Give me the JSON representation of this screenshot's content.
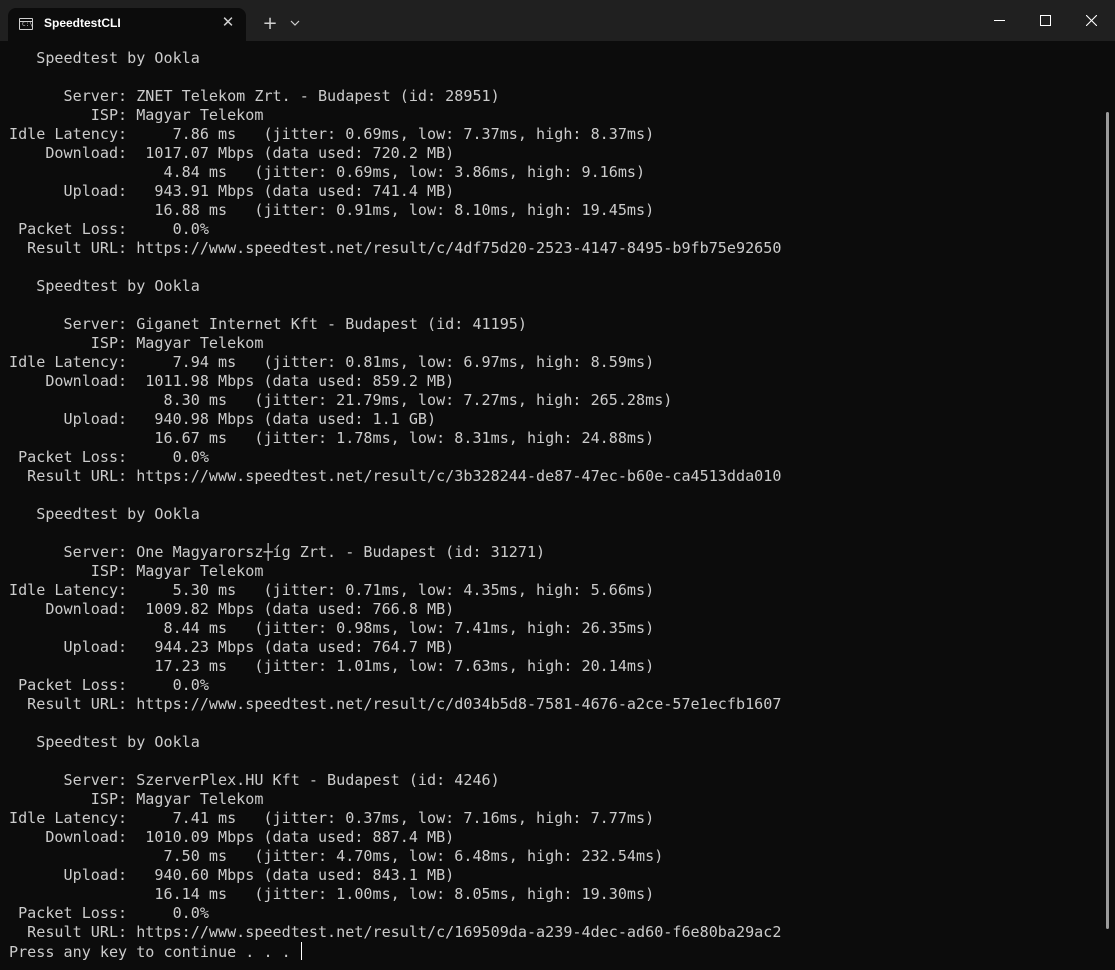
{
  "window": {
    "tab_title": "SpeedtestCLI",
    "tab_icon": "terminal-icon",
    "new_tab_label": "+",
    "close_tab_label": "✕"
  },
  "colors": {
    "background": "#0c0c0c",
    "titlebar": "#202020",
    "text": "#cccccc"
  },
  "terminal": {
    "lines": [
      "   Speedtest by Ookla",
      "",
      "      Server: ZNET Telekom Zrt. - Budapest (id: 28951)",
      "         ISP: Magyar Telekom",
      "Idle Latency:     7.86 ms   (jitter: 0.69ms, low: 7.37ms, high: 8.37ms)",
      "    Download:  1017.07 Mbps (data used: 720.2 MB)",
      "                 4.84 ms   (jitter: 0.69ms, low: 3.86ms, high: 9.16ms)",
      "      Upload:   943.91 Mbps (data used: 741.4 MB)",
      "                16.88 ms   (jitter: 0.91ms, low: 8.10ms, high: 19.45ms)",
      " Packet Loss:     0.0%",
      "  Result URL: https://www.speedtest.net/result/c/4df75d20-2523-4147-8495-b9fb75e92650",
      "",
      "   Speedtest by Ookla",
      "",
      "      Server: Giganet Internet Kft - Budapest (id: 41195)",
      "         ISP: Magyar Telekom",
      "Idle Latency:     7.94 ms   (jitter: 0.81ms, low: 6.97ms, high: 8.59ms)",
      "    Download:  1011.98 Mbps (data used: 859.2 MB)",
      "                 8.30 ms   (jitter: 21.79ms, low: 7.27ms, high: 265.28ms)",
      "      Upload:   940.98 Mbps (data used: 1.1 GB)",
      "                16.67 ms   (jitter: 1.78ms, low: 8.31ms, high: 24.88ms)",
      " Packet Loss:     0.0%",
      "  Result URL: https://www.speedtest.net/result/c/3b328244-de87-47ec-b60e-ca4513dda010",
      "",
      "   Speedtest by Ookla",
      "",
      "      Server: One Magyarorsz┼íg Zrt. - Budapest (id: 31271)",
      "         ISP: Magyar Telekom",
      "Idle Latency:     5.30 ms   (jitter: 0.71ms, low: 4.35ms, high: 5.66ms)",
      "    Download:  1009.82 Mbps (data used: 766.8 MB)",
      "                 8.44 ms   (jitter: 0.98ms, low: 7.41ms, high: 26.35ms)",
      "      Upload:   944.23 Mbps (data used: 764.7 MB)",
      "                17.23 ms   (jitter: 1.01ms, low: 7.63ms, high: 20.14ms)",
      " Packet Loss:     0.0%",
      "  Result URL: https://www.speedtest.net/result/c/d034b5d8-7581-4676-a2ce-57e1ecfb1607",
      "",
      "   Speedtest by Ookla",
      "",
      "      Server: SzerverPlex.HU Kft - Budapest (id: 4246)",
      "         ISP: Magyar Telekom",
      "Idle Latency:     7.41 ms   (jitter: 0.37ms, low: 7.16ms, high: 7.77ms)",
      "    Download:  1010.09 Mbps (data used: 887.4 MB)",
      "                 7.50 ms   (jitter: 4.70ms, low: 6.48ms, high: 232.54ms)",
      "      Upload:   940.60 Mbps (data used: 843.1 MB)",
      "                16.14 ms   (jitter: 1.00ms, low: 8.05ms, high: 19.30ms)",
      " Packet Loss:     0.0%",
      "  Result URL: https://www.speedtest.net/result/c/169509da-a239-4dec-ad60-f6e80ba29ac2"
    ],
    "prompt": "Press any key to continue . . . "
  }
}
